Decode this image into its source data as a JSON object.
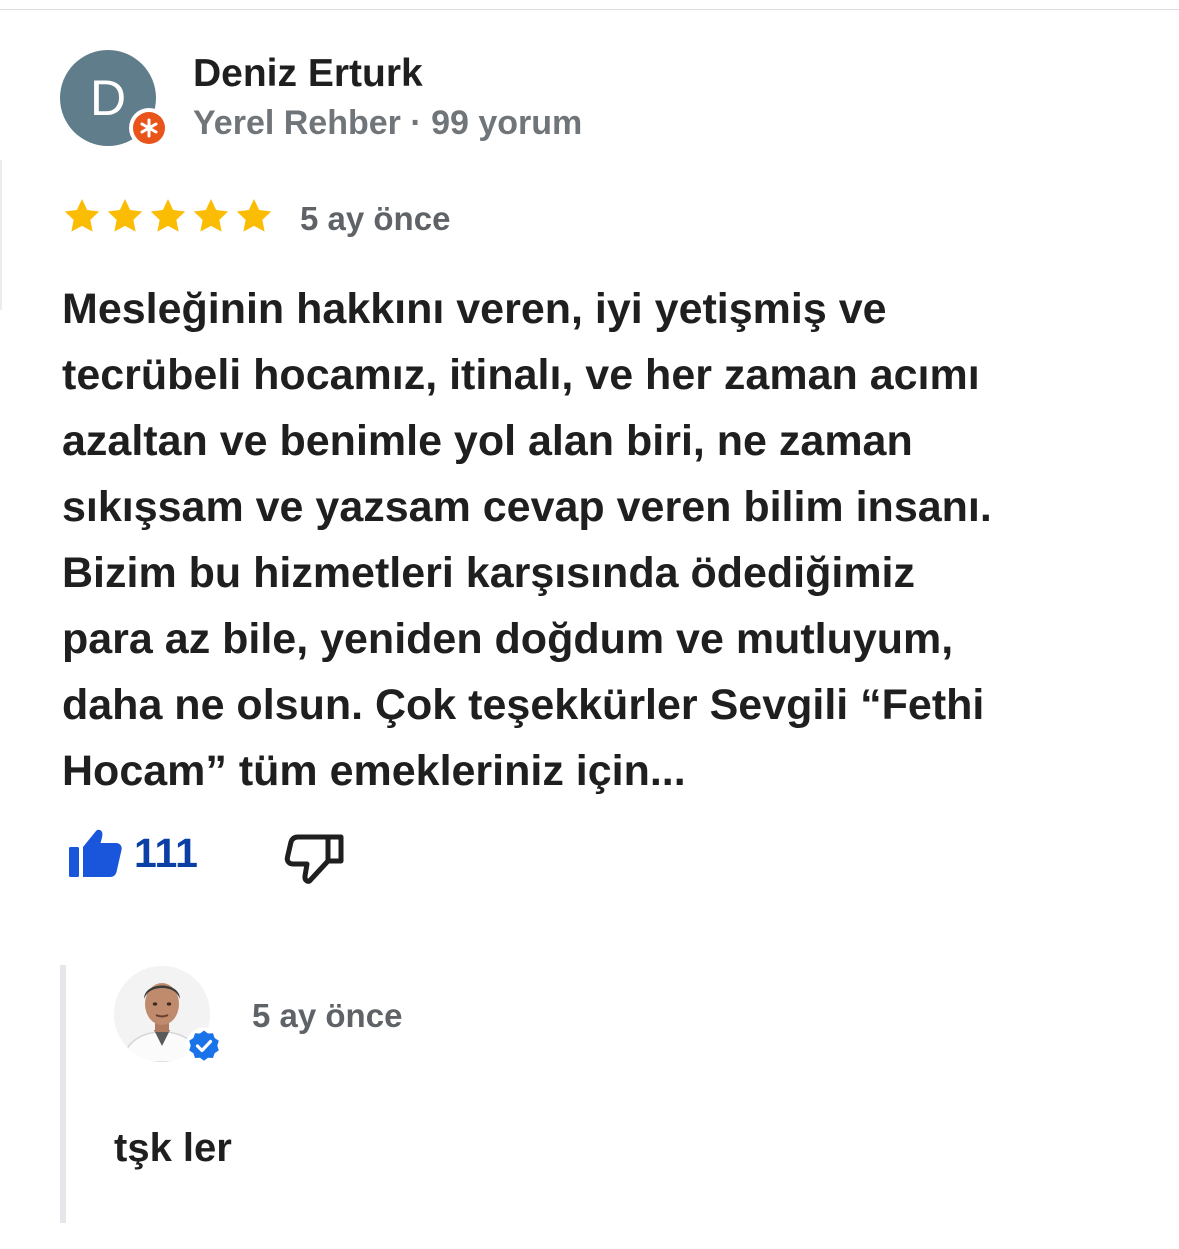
{
  "review": {
    "author": {
      "initial": "D",
      "name": "Deniz Erturk",
      "meta": "Yerel Rehber · 99 yorum",
      "avatar_color": "#607d8b",
      "badge_icon": "local-guide-star-icon",
      "badge_color": "#e8541a"
    },
    "rating": {
      "stars": 5,
      "max": 5,
      "star_color": "#fbbc04",
      "icon": "star-icon"
    },
    "time": "5 ay önce",
    "text": "Mesleğinin hakkını veren, iyi yetişmiş ve\ntecrübeli hocamız, itinalı, ve her zaman  acımı\nazaltan ve benimle yol alan biri, ne zaman\nsıkışsam ve yazsam cevap veren bilim insanı.\nBizim bu hizmetleri karşısında ödediğimiz\npara az bile, yeniden doğdum ve mutluyum,\ndaha ne olsun. Çok teşekkürler Sevgili “Fethi\nHocam” tüm emekleriniz için...",
    "actions": {
      "like_icon": "thumbs-up-icon",
      "like_count": "111",
      "like_color": "#1a56db",
      "dislike_icon": "thumbs-down-icon"
    }
  },
  "owner_reply": {
    "avatar_icon": "owner-photo-avatar",
    "verified_icon": "verified-check-icon",
    "verified_color": "#1a73e8",
    "time": "5 ay önce",
    "text": "tşk ler"
  }
}
